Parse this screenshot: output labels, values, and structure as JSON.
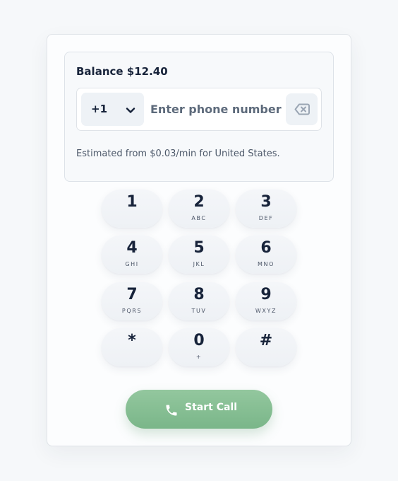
{
  "balance": {
    "label": "Balance $12.40"
  },
  "phone": {
    "country_code": "+1",
    "placeholder": "Enter phone number",
    "value": ""
  },
  "estimate": "Estimated from $0.03/min for United States.",
  "keypad": [
    {
      "digit": "1",
      "letters": ""
    },
    {
      "digit": "2",
      "letters": "ABC"
    },
    {
      "digit": "3",
      "letters": "DEF"
    },
    {
      "digit": "4",
      "letters": "GHI"
    },
    {
      "digit": "5",
      "letters": "JKL"
    },
    {
      "digit": "6",
      "letters": "MNO"
    },
    {
      "digit": "7",
      "letters": "PQRS"
    },
    {
      "digit": "8",
      "letters": "TUV"
    },
    {
      "digit": "9",
      "letters": "WXYZ"
    },
    {
      "digit": "*",
      "letters": ""
    },
    {
      "digit": "0",
      "letters": "+"
    },
    {
      "digit": "#",
      "letters": ""
    }
  ],
  "call_button": {
    "label": "Start Call"
  },
  "icons": {
    "country_dropdown": "chevron-down-icon",
    "backspace": "backspace-icon",
    "call": "phone-icon"
  },
  "colors": {
    "accent": "#86bf93",
    "text": "#17233a",
    "muted": "#4c5869"
  }
}
